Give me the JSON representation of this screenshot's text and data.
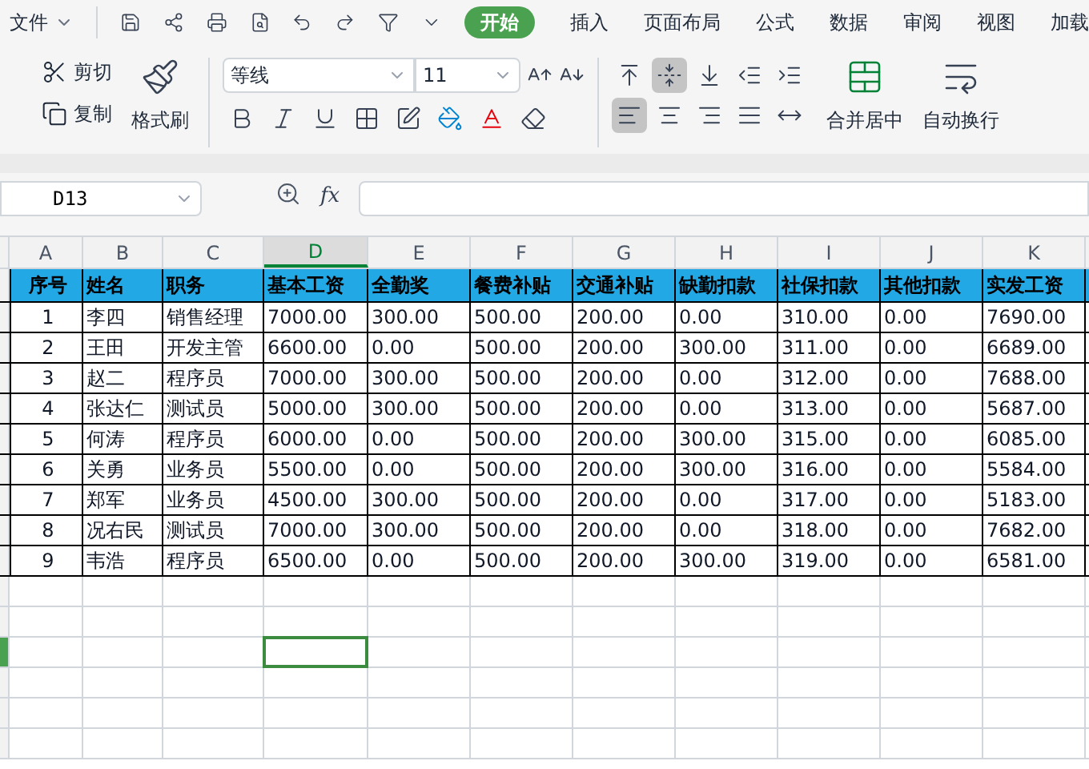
{
  "menu": {
    "file": "文件",
    "tabs": [
      {
        "label": "开始",
        "selected": true
      },
      {
        "label": "插入",
        "selected": false
      },
      {
        "label": "页面布局",
        "selected": false
      },
      {
        "label": "公式",
        "selected": false
      },
      {
        "label": "数据",
        "selected": false
      },
      {
        "label": "审阅",
        "selected": false
      },
      {
        "label": "视图",
        "selected": false
      },
      {
        "label": "加载",
        "selected": false
      }
    ]
  },
  "ribbon": {
    "cut": "剪切",
    "copy": "复制",
    "format_painter": "格式刷",
    "font_name": "等线",
    "font_size": "11",
    "merge": "合并居中",
    "wrap": "自动换行",
    "align_top": [
      {
        "kind": "top",
        "selected": false
      },
      {
        "kind": "middle",
        "selected": true
      },
      {
        "kind": "bottom",
        "selected": false
      },
      {
        "kind": "outdent",
        "selected": false
      },
      {
        "kind": "indent",
        "selected": false
      }
    ],
    "align_bottom": [
      {
        "kind": "left",
        "selected": true
      },
      {
        "kind": "center",
        "selected": false
      },
      {
        "kind": "right",
        "selected": false
      },
      {
        "kind": "justify",
        "selected": false
      },
      {
        "kind": "distributed",
        "selected": false
      }
    ]
  },
  "name_box": "D13",
  "fx": "fx",
  "columns": [
    {
      "letter": "A",
      "selected": false
    },
    {
      "letter": "B",
      "selected": false
    },
    {
      "letter": "C",
      "selected": false
    },
    {
      "letter": "D",
      "selected": true
    },
    {
      "letter": "E",
      "selected": false
    },
    {
      "letter": "F",
      "selected": false
    },
    {
      "letter": "G",
      "selected": false
    },
    {
      "letter": "H",
      "selected": false
    },
    {
      "letter": "I",
      "selected": false
    },
    {
      "letter": "J",
      "selected": false
    },
    {
      "letter": "K",
      "selected": false
    }
  ],
  "header": [
    "序号",
    "姓名",
    "职务",
    "基本工资",
    "全勤奖",
    "餐费补贴",
    "交通补贴",
    "缺勤扣款",
    "社保扣款",
    "其他扣款",
    "实发工资"
  ],
  "rows": [
    [
      "1",
      "李四",
      "销售经理",
      "7000.00",
      "300.00",
      "500.00",
      "200.00",
      "0.00",
      "310.00",
      "0.00",
      "7690.00"
    ],
    [
      "2",
      "王田",
      "开发主管",
      "6600.00",
      "0.00",
      "500.00",
      "200.00",
      "300.00",
      "311.00",
      "0.00",
      "6689.00"
    ],
    [
      "3",
      "赵二",
      "程序员",
      "7000.00",
      "300.00",
      "500.00",
      "200.00",
      "0.00",
      "312.00",
      "0.00",
      "7688.00"
    ],
    [
      "4",
      "张达仁",
      "测试员",
      "5000.00",
      "300.00",
      "500.00",
      "200.00",
      "0.00",
      "313.00",
      "0.00",
      "5687.00"
    ],
    [
      "5",
      "何涛",
      "程序员",
      "6000.00",
      "0.00",
      "500.00",
      "200.00",
      "300.00",
      "315.00",
      "0.00",
      "6085.00"
    ],
    [
      "6",
      "关勇",
      "业务员",
      "5500.00",
      "0.00",
      "500.00",
      "200.00",
      "300.00",
      "316.00",
      "0.00",
      "5584.00"
    ],
    [
      "7",
      "郑军",
      "业务员",
      "4500.00",
      "300.00",
      "500.00",
      "200.00",
      "0.00",
      "317.00",
      "0.00",
      "5183.00"
    ],
    [
      "8",
      "况右民",
      "测试员",
      "7000.00",
      "300.00",
      "500.00",
      "200.00",
      "0.00",
      "318.00",
      "0.00",
      "7682.00"
    ],
    [
      "9",
      "韦浩",
      "程序员",
      "6500.00",
      "0.00",
      "500.00",
      "200.00",
      "300.00",
      "319.00",
      "0.00",
      "6581.00"
    ]
  ],
  "empty_rows": [
    {
      "selected": false
    },
    {
      "selected": false
    },
    {
      "selected": true
    },
    {
      "selected": false
    },
    {
      "selected": false
    },
    {
      "selected": false
    }
  ]
}
